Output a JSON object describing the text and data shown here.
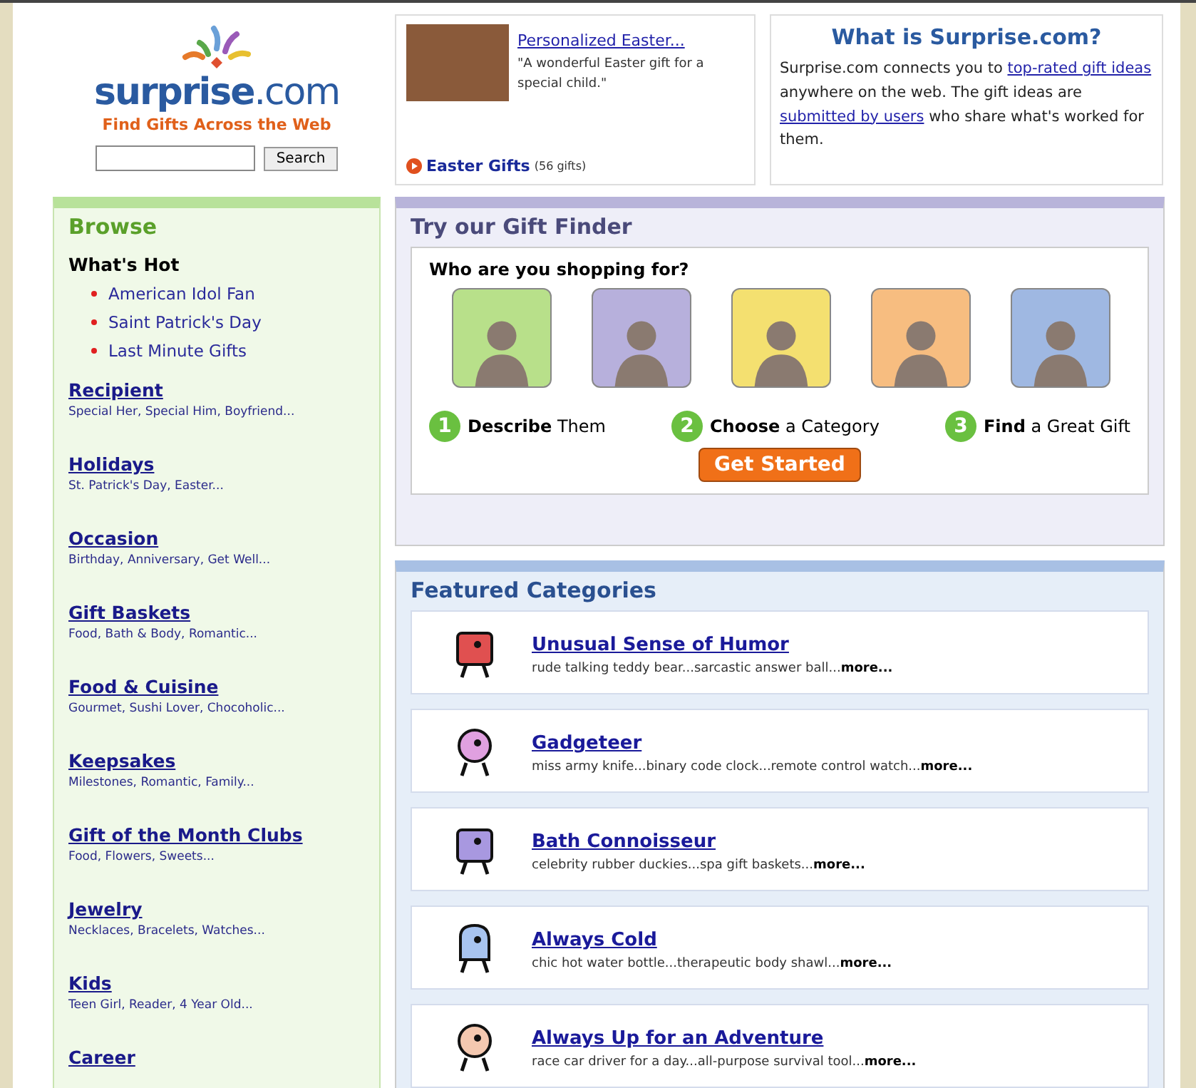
{
  "header": {
    "logo": "**surprise**.com",
    "tagline": "Find Gifts Across the Web",
    "search_button": "Search",
    "promo": {
      "title": "Personalized Easter...",
      "quote": "\"A wonderful Easter gift for a special child.\"",
      "link": "Easter Gifts",
      "count": "(56 gifts)"
    },
    "about": {
      "title": "What is Surprise.com?",
      "parts": [
        {
          "kind": "text",
          "text": "Surprise.com connects you to "
        },
        {
          "kind": "link",
          "text": "top-rated gift ideas"
        },
        {
          "kind": "text",
          "text": " anywhere on the web. The gift ideas are "
        },
        {
          "kind": "link",
          "text": "submitted by users"
        },
        {
          "kind": "text",
          "text": " who share what's worked for them."
        }
      ]
    }
  },
  "sidebar": {
    "title": "Browse",
    "hot_title": "What's Hot",
    "hot": [
      "American Idol Fan",
      "Saint Patrick's Day",
      "Last Minute Gifts"
    ],
    "sections": [
      {
        "title": "Recipient",
        "sub": "Special Her, Special Him, Boyfriend..."
      },
      {
        "title": "Holidays",
        "sub": "St. Patrick's Day, Easter..."
      },
      {
        "title": "Occasion",
        "sub": "Birthday, Anniversary, Get Well..."
      },
      {
        "title": "Gift Baskets",
        "sub": "Food, Bath & Body, Romantic..."
      },
      {
        "title": "Food & Cuisine",
        "sub": "Gourmet, Sushi Lover, Chocoholic..."
      },
      {
        "title": "Keepsakes",
        "sub": "Milestones, Romantic, Family..."
      },
      {
        "title": "Gift of the Month Clubs",
        "sub": "Food, Flowers, Sweets..."
      },
      {
        "title": "Jewelry",
        "sub": "Necklaces, Bracelets, Watches..."
      },
      {
        "title": "Kids",
        "sub": "Teen Girl, Reader, 4 Year Old..."
      },
      {
        "title": "Career"
      }
    ]
  },
  "gift_finder": {
    "title": "Try our Gift Finder",
    "question": "Who are you shopping for?",
    "people": [
      {
        "color": "#b8e08a"
      },
      {
        "color": "#b7b0dc"
      },
      {
        "color": "#f4e070"
      },
      {
        "color": "#f7bd80"
      },
      {
        "color": "#9fb8e2"
      }
    ],
    "steps": [
      {
        "number": "1",
        "text": "**Describe** Them"
      },
      {
        "number": "2",
        "text": "**Choose** a Category"
      },
      {
        "number": "3",
        "text": "**Find** a Great Gift"
      }
    ],
    "button": "Get Started"
  },
  "featured": {
    "title": "Featured Categories",
    "items": [
      {
        "kind": "robot",
        "title": "Unusual Sense of Humor",
        "desc": "rude talking teddy bear...sarcastic answer ball...**more...**"
      },
      {
        "kind": "gear",
        "title": "Gadgeteer",
        "desc": "miss army knife...binary code clock...remote control watch...**more...**"
      },
      {
        "kind": "soap",
        "title": "Bath Connoisseur",
        "desc": "celebrity rubber duckies...spa gift baskets...**more...**"
      },
      {
        "kind": "mitten",
        "title": "Always Cold",
        "desc": "chic hot water bottle...therapeutic body shawl...**more...**"
      },
      {
        "kind": "rider",
        "title": "Always Up for an Adventure",
        "desc": "race car driver for a day...all-purpose survival tool...**more...**"
      }
    ]
  }
}
